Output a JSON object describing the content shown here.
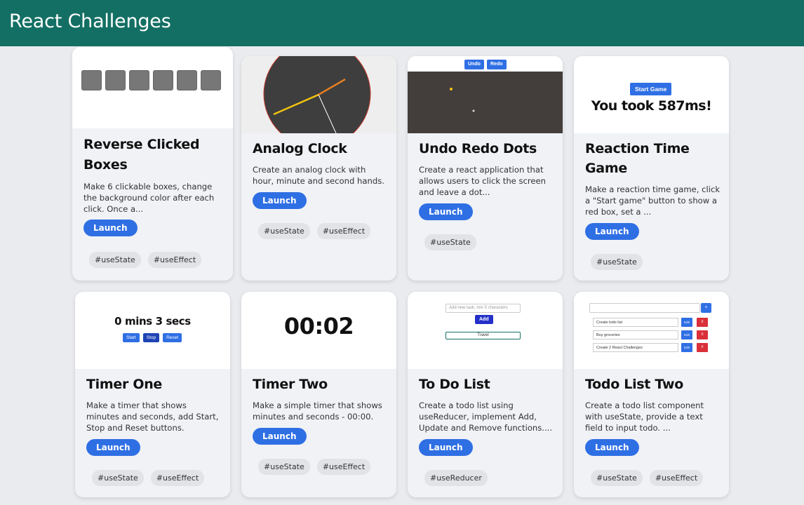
{
  "header": {
    "title": "React Challenges"
  },
  "cards": [
    {
      "title": "Reverse Clicked Boxes",
      "description": "Make 6 clickable boxes, change the background color after each click. Once a...",
      "launch": "Launch",
      "tags": [
        "#useState",
        "#useEffect"
      ]
    },
    {
      "title": "Analog Clock",
      "description": "Create an analog clock with hour, minute and second hands.",
      "launch": "Launch",
      "tags": [
        "#useState",
        "#useEffect"
      ]
    },
    {
      "title": "Undo Redo Dots",
      "description": "Create a react application that allows users to click the screen and leave a dot...",
      "launch": "Launch",
      "tags": [
        "#useState"
      ],
      "preview": {
        "undo": "Undo",
        "redo": "Redo"
      }
    },
    {
      "title": "Reaction Time Game",
      "description": "Make a reaction time game, click a \"Start game\" button to show a red box, set a ...",
      "launch": "Launch",
      "tags": [
        "#useState"
      ],
      "preview": {
        "button": "Start Game",
        "result": "You took 587ms!"
      }
    },
    {
      "title": "Timer One",
      "description": "Make a timer that shows minutes and seconds, add Start, Stop and Reset buttons.",
      "launch": "Launch",
      "tags": [
        "#useState",
        "#useEffect"
      ],
      "preview": {
        "time": "0 mins 3 secs",
        "start": "Start",
        "stop": "Stop",
        "reset": "Reset"
      }
    },
    {
      "title": "Timer Two",
      "description": "Make a simple timer that shows minutes and seconds - 00:00.",
      "launch": "Launch",
      "tags": [
        "#useState",
        "#useEffect"
      ],
      "preview": {
        "time": "00:02"
      }
    },
    {
      "title": "To Do List",
      "description": "Create a todo list using useReducer, implement Add, Update and Remove functions....",
      "launch": "Launch",
      "tags": [
        "#useReducer"
      ],
      "preview": {
        "placeholder": "Add new task, min 5 characters",
        "add": "Add",
        "item": "Travel"
      }
    },
    {
      "title": "Todo List Two",
      "description": "Create a todo list component with useState, provide a text field to input todo. ...",
      "launch": "Launch",
      "tags": [
        "#useState",
        "#useEffect"
      ],
      "preview": {
        "plus": "+",
        "items": [
          "Create todo list",
          "Buy groceries",
          "Create 2 React Challenges"
        ],
        "edit": "Edit",
        "delete": "X"
      }
    }
  ]
}
